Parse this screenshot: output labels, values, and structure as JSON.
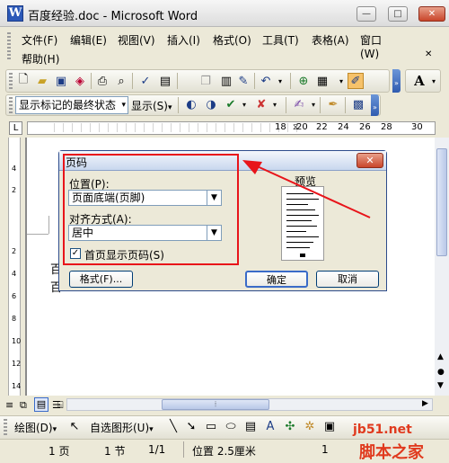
{
  "window": {
    "title": "百度经验.doc - Microsoft Word",
    "app_icon": "W",
    "minimize": "—",
    "maximize": "□",
    "close": "✕"
  },
  "menu": {
    "items": [
      "文件(F)",
      "编辑(E)",
      "视图(V)",
      "插入(I)",
      "格式(O)",
      "工具(T)",
      "表格(A)",
      "窗口(W)",
      "帮助(H)"
    ],
    "help_icon": "A"
  },
  "toolbar2": {
    "markup_view": "显示标记的最终状态",
    "show": "显示(S)"
  },
  "ruler": {
    "numbers": [
      "18",
      "20",
      "22",
      "24",
      "26",
      "28",
      "30"
    ],
    "tab_marker": "L"
  },
  "vruler": {
    "numbers": [
      "4",
      "2",
      "2",
      "4",
      "6",
      "8",
      "10",
      "12",
      "14"
    ]
  },
  "dialog": {
    "title": "页码",
    "close": "✕",
    "position_label": "位置(P):",
    "position_value": "页面底端(页脚)",
    "align_label": "对齐方式(A):",
    "align_value": "居中",
    "first_page_label": "首页显示页码(S)",
    "first_page_checked": "✓",
    "preview_label": "预览",
    "format_button": "格式(F)...",
    "ok_button": "确定",
    "cancel_button": "取消"
  },
  "document": {
    "line1": "百",
    "line2": "百"
  },
  "drawing": {
    "draw": "绘图(D)",
    "autoshapes": "自选图形(U)"
  },
  "status": {
    "page": "1 页",
    "section": "1 节",
    "page_of": "1/1",
    "position": "位置 2.5厘米",
    "col": "1"
  },
  "watermark": {
    "site": "jb51.net",
    "name": "脚本之家"
  },
  "colors": {
    "highlight": "#e8141a",
    "dialog_border": "#2d4c8c",
    "close_red": "#c9452a"
  }
}
